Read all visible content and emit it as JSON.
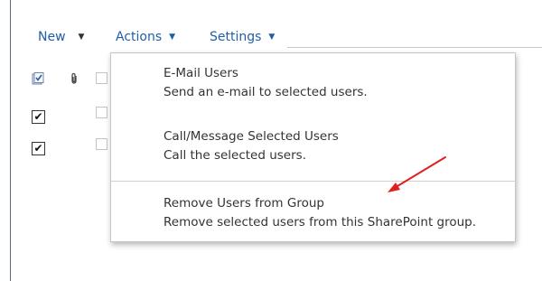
{
  "toolbar": {
    "new_label": "New",
    "actions_label": "Actions",
    "settings_label": "Settings",
    "caret": "▼"
  },
  "list": {
    "rows": [
      {
        "checked": true,
        "check_glyph": "✔"
      },
      {
        "checked": true,
        "check_glyph": "✔"
      }
    ],
    "attachment_glyph": "📎"
  },
  "actions_menu": {
    "items": [
      {
        "title": "E-Mail Users",
        "description": "Send an e-mail to selected users."
      },
      {
        "title": "Call/Message Selected Users",
        "description": "Call the selected users."
      },
      {
        "title": "Remove Users from Group",
        "description": "Remove selected users from this SharePoint group."
      }
    ]
  },
  "colors": {
    "link": "#1f5fa8",
    "annotation_arrow": "#e02020"
  }
}
